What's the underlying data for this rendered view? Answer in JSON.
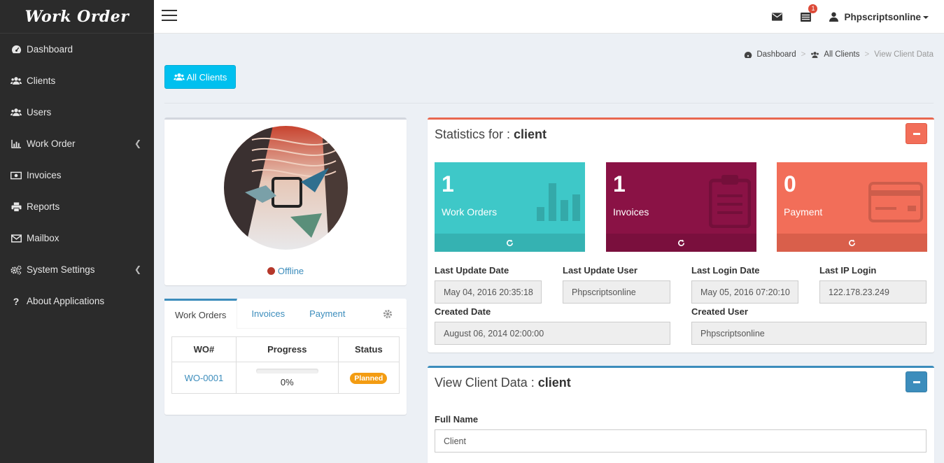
{
  "app": {
    "title": "Work Order"
  },
  "sidebar": {
    "items": [
      {
        "label": "Dashboard",
        "icon": "dashboard-icon"
      },
      {
        "label": "Clients",
        "icon": "users-icon"
      },
      {
        "label": "Users",
        "icon": "users-icon"
      },
      {
        "label": "Work Order",
        "icon": "bar-chart-icon",
        "has_arrow": true
      },
      {
        "label": "Invoices",
        "icon": "money-icon"
      },
      {
        "label": "Reports",
        "icon": "print-icon"
      },
      {
        "label": "Mailbox",
        "icon": "envelope-icon"
      },
      {
        "label": "System Settings",
        "icon": "cogs-icon",
        "has_arrow": true
      },
      {
        "label": "About Applications",
        "icon": "question-icon"
      }
    ]
  },
  "topbar": {
    "notification_count": "1",
    "user_name": "Phpscriptsonline"
  },
  "breadcrumb": {
    "home": "Dashboard",
    "clients": "All Clients",
    "current": "View Client Data"
  },
  "toolbar": {
    "all_clients_label": "All Clients"
  },
  "profile": {
    "status": "Offline"
  },
  "tabs": {
    "items": [
      "Work Orders",
      "Invoices",
      "Payment"
    ],
    "table": {
      "headers": [
        "WO#",
        "Progress",
        "Status"
      ],
      "rows": [
        {
          "wo": "WO-0001",
          "progress_text": "0%",
          "progress_value": 0,
          "status": "Planned"
        }
      ]
    }
  },
  "stats": {
    "title_prefix": "Statistics for : ",
    "client": "client",
    "cards": [
      {
        "value": "1",
        "label": "Work Orders",
        "color": "#3ec8c8"
      },
      {
        "value": "1",
        "label": "Invoices",
        "color": "#8a1245"
      },
      {
        "value": "0",
        "label": "Payment",
        "color": "#f26e59"
      }
    ],
    "fields": {
      "last_update_date_label": "Last Update Date",
      "last_update_date": "May 04, 2016 20:35:18",
      "last_update_user_label": "Last Update User",
      "last_update_user": "Phpscriptsonline",
      "last_login_date_label": "Last Login Date",
      "last_login_date": "May 05, 2016 07:20:10",
      "last_ip_login_label": "Last IP Login",
      "last_ip_login": "122.178.23.249",
      "created_date_label": "Created Date",
      "created_date": "August 06, 2014 02:00:00",
      "created_user_label": "Created User",
      "created_user": "Phpscriptsonline"
    }
  },
  "view_client": {
    "title_prefix": "View Client Data : ",
    "client": "client",
    "full_name_label": "Full Name",
    "full_name": "Client"
  },
  "colors": {
    "accent_blue": "#3c8dbc",
    "btn_info": "#00c0ef",
    "danger": "#f26e59",
    "sidebar_bg": "#2b2b2b"
  }
}
